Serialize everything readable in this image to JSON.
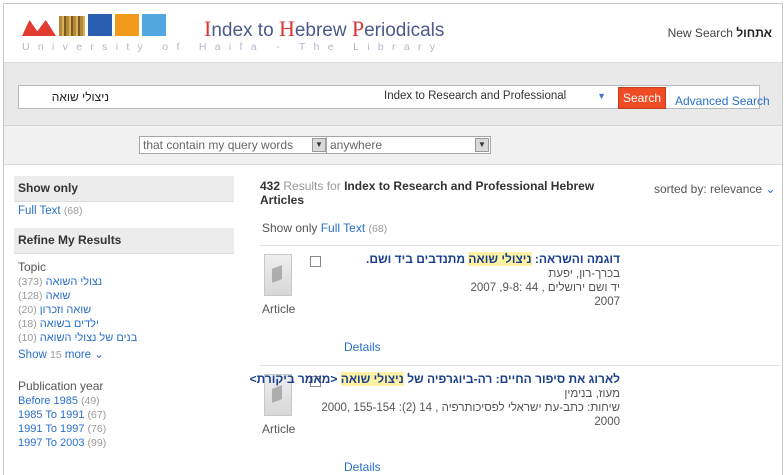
{
  "header": {
    "logo_text_1": "ndex to ",
    "logo_I": "I",
    "logo_H": "H",
    "logo_text_2": "ebrew ",
    "logo_P": "P",
    "logo_text_3": "eriodicals",
    "university_line": "University of Haifa - The Library",
    "new_search_label": "New Search",
    "new_search_hebrew": "אתחול"
  },
  "search": {
    "query": "ניצולי שואה",
    "database": "Index to Research and Professional",
    "search_button": "Search",
    "advanced_link": "Advanced Search"
  },
  "filters": {
    "match_mode": "that contain my query words",
    "scope": "anywhere"
  },
  "sidebar": {
    "show_only_heading": "Show only",
    "full_text_label": "Full Text",
    "full_text_count": "(68)",
    "refine_heading": "Refine My Results",
    "topic_heading": "Topic",
    "topics": [
      {
        "label": "נצולי השואה",
        "count": "(373)"
      },
      {
        "label": "שואה",
        "count": "(128)"
      },
      {
        "label": "שואה וזכרון",
        "count": "(20)"
      },
      {
        "label": "ילדים בשואה",
        "count": "(18)"
      },
      {
        "label": "בנים של נצולי השואה",
        "count": "(10)"
      }
    ],
    "show_label": "Show",
    "show_count": "15",
    "more_label": "more",
    "pubyear_heading": "Publication year",
    "years": [
      {
        "label": "Before 1985",
        "count": "(49)"
      },
      {
        "label": "1985 To 1991",
        "count": "(67)"
      },
      {
        "label": "1991 To 1997",
        "count": "(76)"
      },
      {
        "label": "1997 To 2003",
        "count": "(99)"
      }
    ]
  },
  "results": {
    "count": "432",
    "results_for": "Results for",
    "collection": "Index to Research and Professional Hebrew Articles",
    "sorted_by_label": "sorted by:",
    "sorted_by_value": "relevance",
    "show_only_label": "Show only",
    "full_text_label": "Full Text",
    "full_text_count": "(68)",
    "items": [
      {
        "title_pre": "דוגמה והשראה: ",
        "title_hl": "ניצולי שואה",
        "title_post": " מתנדבים ביד ושם.",
        "authors": "בכרך-רון, יפעת",
        "source": "יד ושם ירושלים , 44 :9-8, 2007",
        "year": "2007",
        "type": "Article",
        "details": "Details"
      },
      {
        "title_pre": "לארוג את סיפור החיים: רה-ביוגרפיה של ",
        "title_hl": "ניצולי שואה",
        "title_post": " <מאמר ביקורת>",
        "authors": "מעוז, בנימין",
        "source": "שיחות: כתב-עת ישראלי לפסיכותרפיה , 14 (2): 155-154 ,2000",
        "year": "2000",
        "type": "Article",
        "details": "Details"
      }
    ]
  }
}
